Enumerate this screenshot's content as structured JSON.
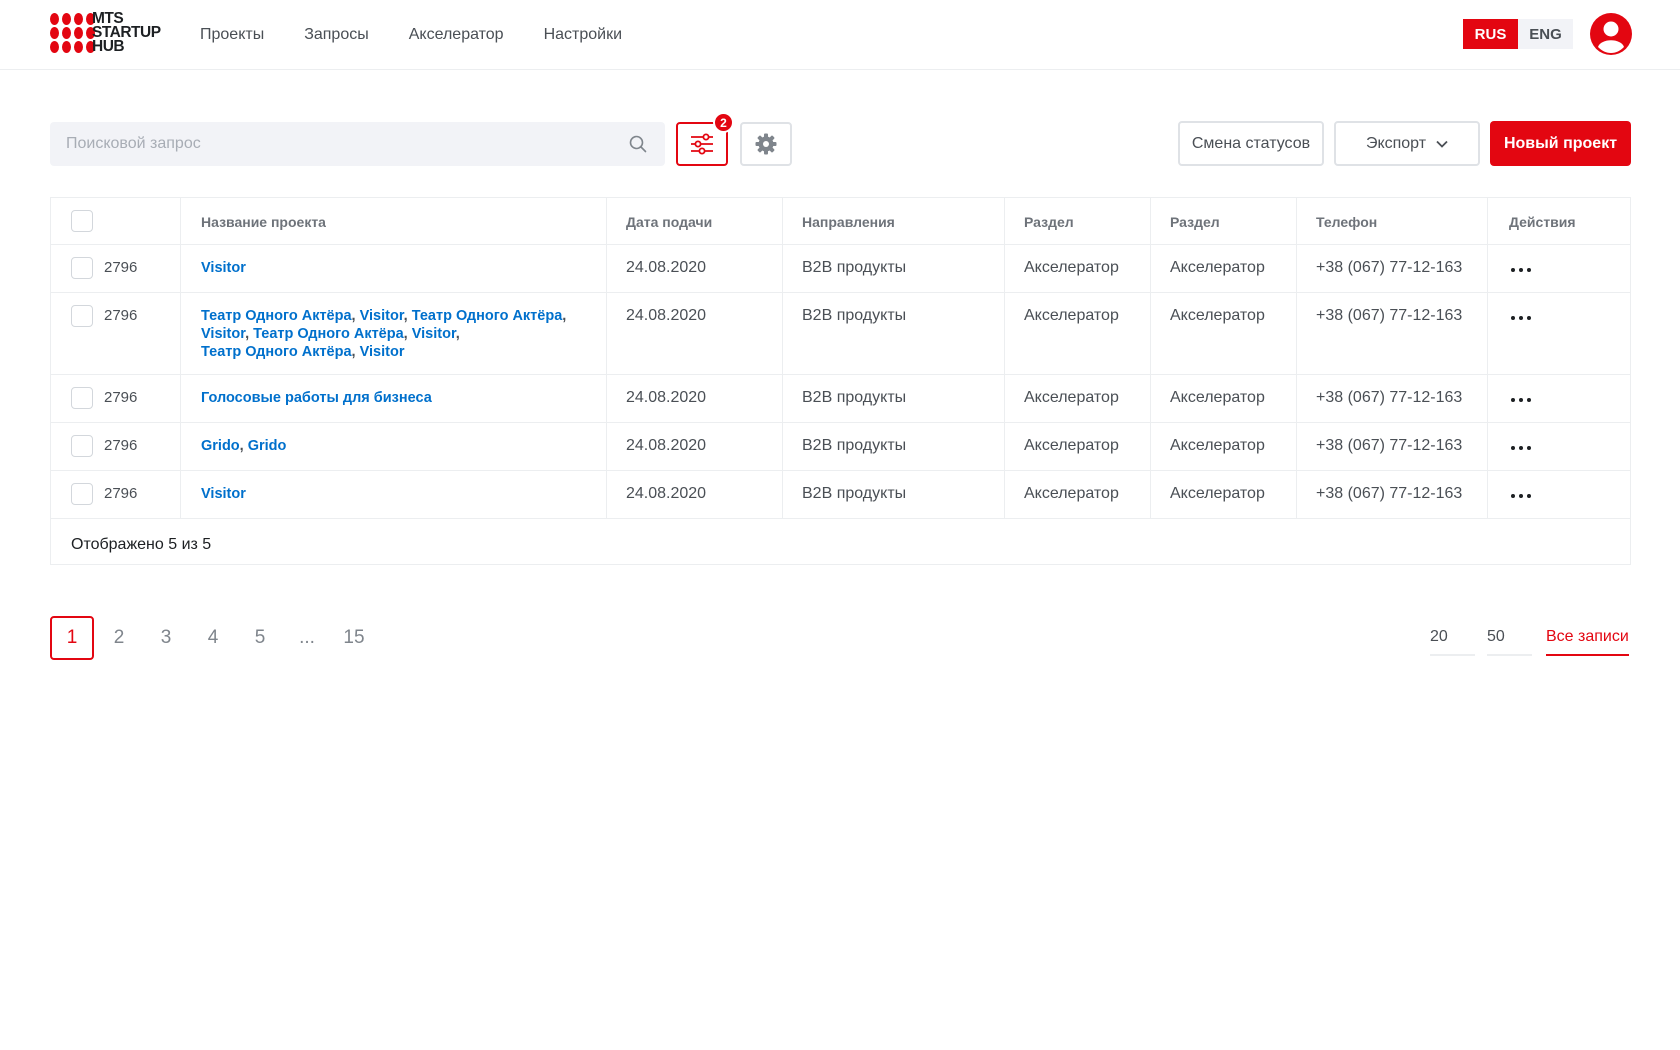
{
  "header": {
    "logo": "MTS STARTUP HUB",
    "nav": [
      {
        "label": "Проекты"
      },
      {
        "label": "Запросы"
      },
      {
        "label": "Акселератор"
      },
      {
        "label": "Настройки"
      }
    ],
    "lang_active": "RUS",
    "lang_inactive": "ENG"
  },
  "colors": {
    "accent": "#e30611",
    "link": "#0070cc"
  },
  "toolbar": {
    "search_placeholder": "Поисковой запрос",
    "filter_badge": "2",
    "status_button": "Смена статусов",
    "export_button": "Экспорт",
    "new_button": "Новый проект"
  },
  "table": {
    "headers": {
      "name": "Название проекта",
      "date": "Дата подачи",
      "direction": "Направления",
      "section1": "Раздел",
      "section2": "Раздел",
      "phone": "Телефон",
      "actions": "Действия"
    },
    "rows": [
      {
        "id": "2796",
        "links": [
          "Visitor"
        ],
        "date": "24.08.2020",
        "direction": "B2B продукты",
        "section1": "Акселератор",
        "section2": "Акселератор",
        "phone": "+38 (067) 77-12-163"
      },
      {
        "id": "2796",
        "links": [
          "Театр Одного Актёра",
          "Visitor",
          "Театр Одного Актёра",
          "Visitor",
          "Театр Одного Актёра",
          "Visitor",
          "Театр Одного Актёра",
          "Visitor"
        ],
        "date": "24.08.2020",
        "direction": "B2B продукты",
        "section1": "Акселератор",
        "section2": "Акселератор",
        "phone": "+38 (067) 77-12-163"
      },
      {
        "id": "2796",
        "links": [
          "Голосовые работы для бизнеса"
        ],
        "date": "24.08.2020",
        "direction": "B2B продукты",
        "section1": "Акселератор",
        "section2": "Акселератор",
        "phone": "+38 (067) 77-12-163"
      },
      {
        "id": "2796",
        "links": [
          "Grido",
          "Grido"
        ],
        "date": "24.08.2020",
        "direction": "B2B продукты",
        "section1": "Акселератор",
        "section2": "Акселератор",
        "phone": "+38 (067) 77-12-163"
      },
      {
        "id": "2796",
        "links": [
          "Visitor"
        ],
        "date": "24.08.2020",
        "direction": "B2B продукты",
        "section1": "Акселератор",
        "section2": "Акселератор",
        "phone": "+38 (067) 77-12-163"
      }
    ],
    "footer": "Отображено 5 из 5"
  },
  "pagination": {
    "pages": [
      "1",
      "2",
      "3",
      "4",
      "5",
      "...",
      "15"
    ],
    "active_page": "1",
    "per_page": [
      "20",
      "50",
      "Все записи"
    ],
    "per_page_active": "Все записи"
  }
}
